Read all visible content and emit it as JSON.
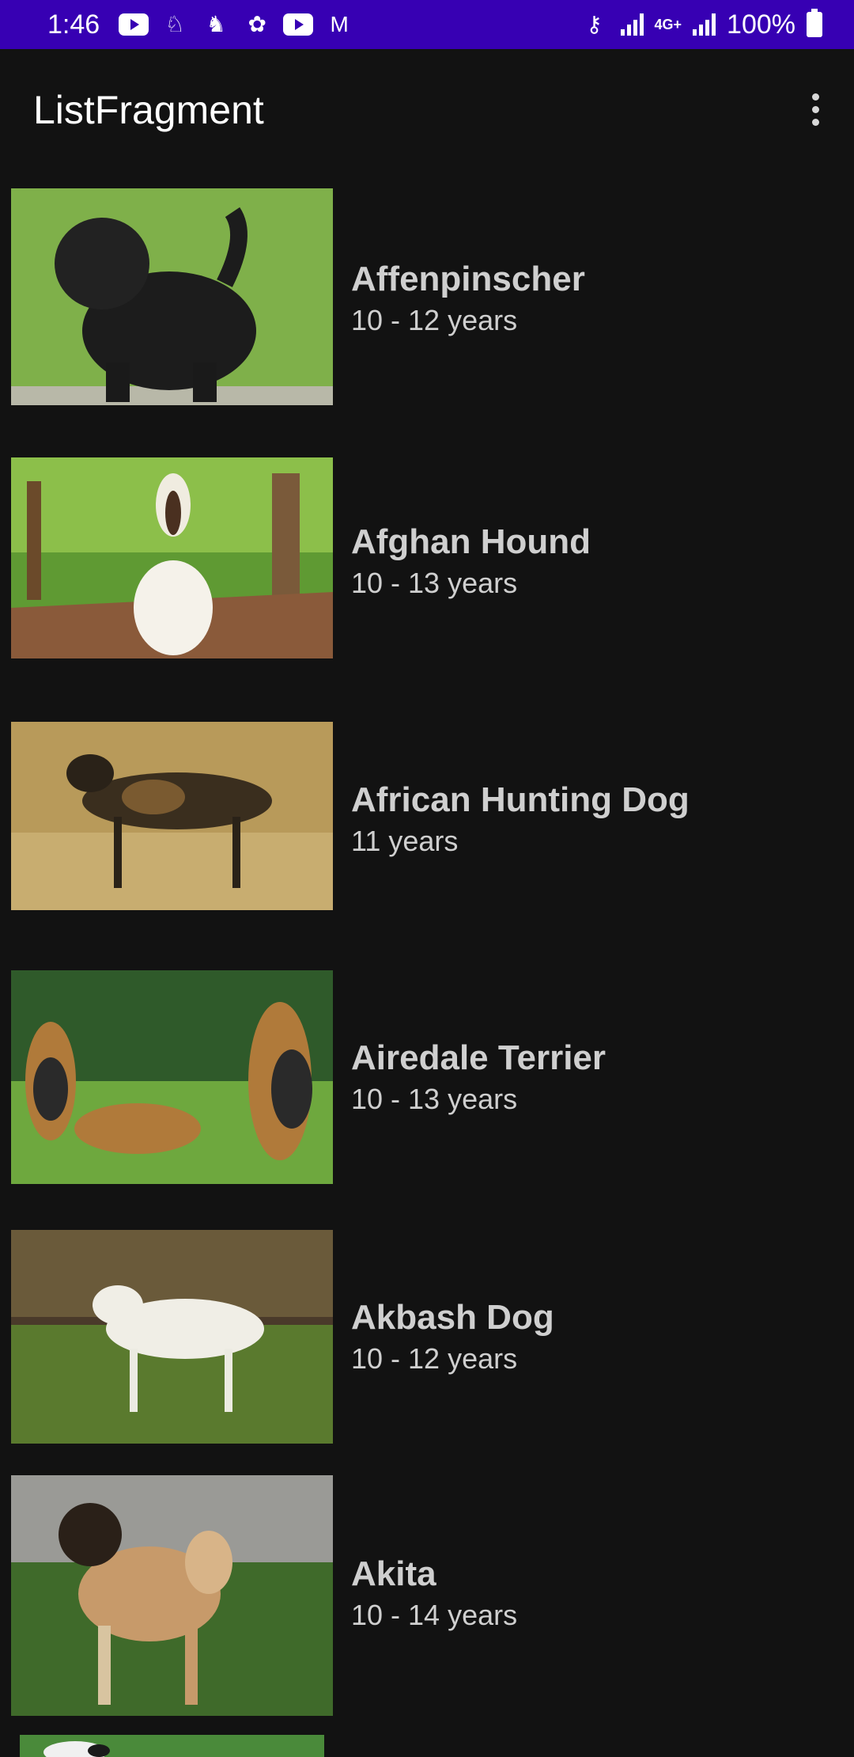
{
  "status_bar": {
    "time": "1:46",
    "battery": "100%",
    "network": "4G+"
  },
  "app_bar": {
    "title": "ListFragment",
    "overflow_icon": "more-vert-icon"
  },
  "list": {
    "items": [
      {
        "name": "Affenpinscher",
        "life_span": "10 - 12 years"
      },
      {
        "name": "Afghan Hound",
        "life_span": "10 - 13 years"
      },
      {
        "name": "African Hunting Dog",
        "life_span": "11 years"
      },
      {
        "name": "Airedale Terrier",
        "life_span": "10 - 13 years"
      },
      {
        "name": "Akbash Dog",
        "life_span": "10 - 12 years"
      },
      {
        "name": "Akita",
        "life_span": "10 - 14 years"
      }
    ]
  },
  "colors": {
    "status_bar": "#3700B3",
    "background": "#121212",
    "text": "#cfcfcf"
  }
}
